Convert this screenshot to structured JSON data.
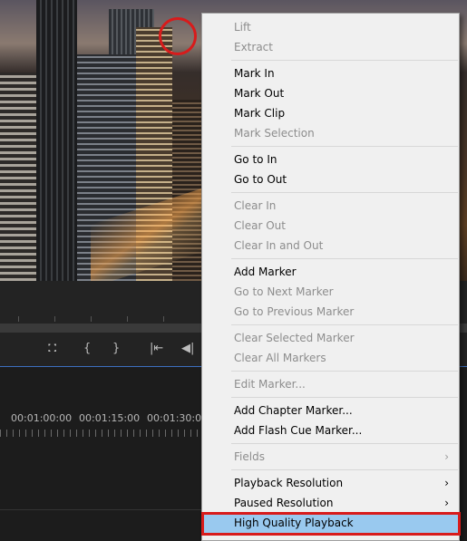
{
  "timeline": {
    "timecodes": [
      "00:01:00:00",
      "00:01:15:00",
      "00:01:30:00"
    ]
  },
  "controls": {
    "icons": [
      "marker-icon",
      "mark-in-icon",
      "mark-out-icon",
      "go-to-in-icon",
      "step-back-icon"
    ]
  },
  "menu": {
    "items": [
      {
        "label": "Lift",
        "enabled": false
      },
      {
        "label": "Extract",
        "enabled": false
      },
      {
        "label": "Mark In",
        "enabled": true
      },
      {
        "label": "Mark Out",
        "enabled": true
      },
      {
        "label": "Mark Clip",
        "enabled": true
      },
      {
        "label": "Mark Selection",
        "enabled": false
      },
      {
        "label": "Go to In",
        "enabled": true
      },
      {
        "label": "Go to Out",
        "enabled": true
      },
      {
        "label": "Clear In",
        "enabled": false
      },
      {
        "label": "Clear Out",
        "enabled": false
      },
      {
        "label": "Clear In and Out",
        "enabled": false
      },
      {
        "label": "Add Marker",
        "enabled": true
      },
      {
        "label": "Go to Next Marker",
        "enabled": false
      },
      {
        "label": "Go to Previous Marker",
        "enabled": false
      },
      {
        "label": "Clear Selected Marker",
        "enabled": false
      },
      {
        "label": "Clear All Markers",
        "enabled": false
      },
      {
        "label": "Edit Marker...",
        "enabled": false
      },
      {
        "label": "Add Chapter Marker...",
        "enabled": true
      },
      {
        "label": "Add Flash Cue Marker...",
        "enabled": true
      },
      {
        "label": "Fields",
        "enabled": false,
        "submenu": true
      },
      {
        "label": "Playback Resolution",
        "enabled": true,
        "submenu": true
      },
      {
        "label": "Paused Resolution",
        "enabled": true,
        "submenu": true
      },
      {
        "label": "High Quality Playback",
        "enabled": true,
        "highlighted": true
      }
    ],
    "submenu_arrow": "›"
  },
  "annotations": {
    "highlight_color": "#d81b1b",
    "hover_color": "#99c9ef"
  }
}
